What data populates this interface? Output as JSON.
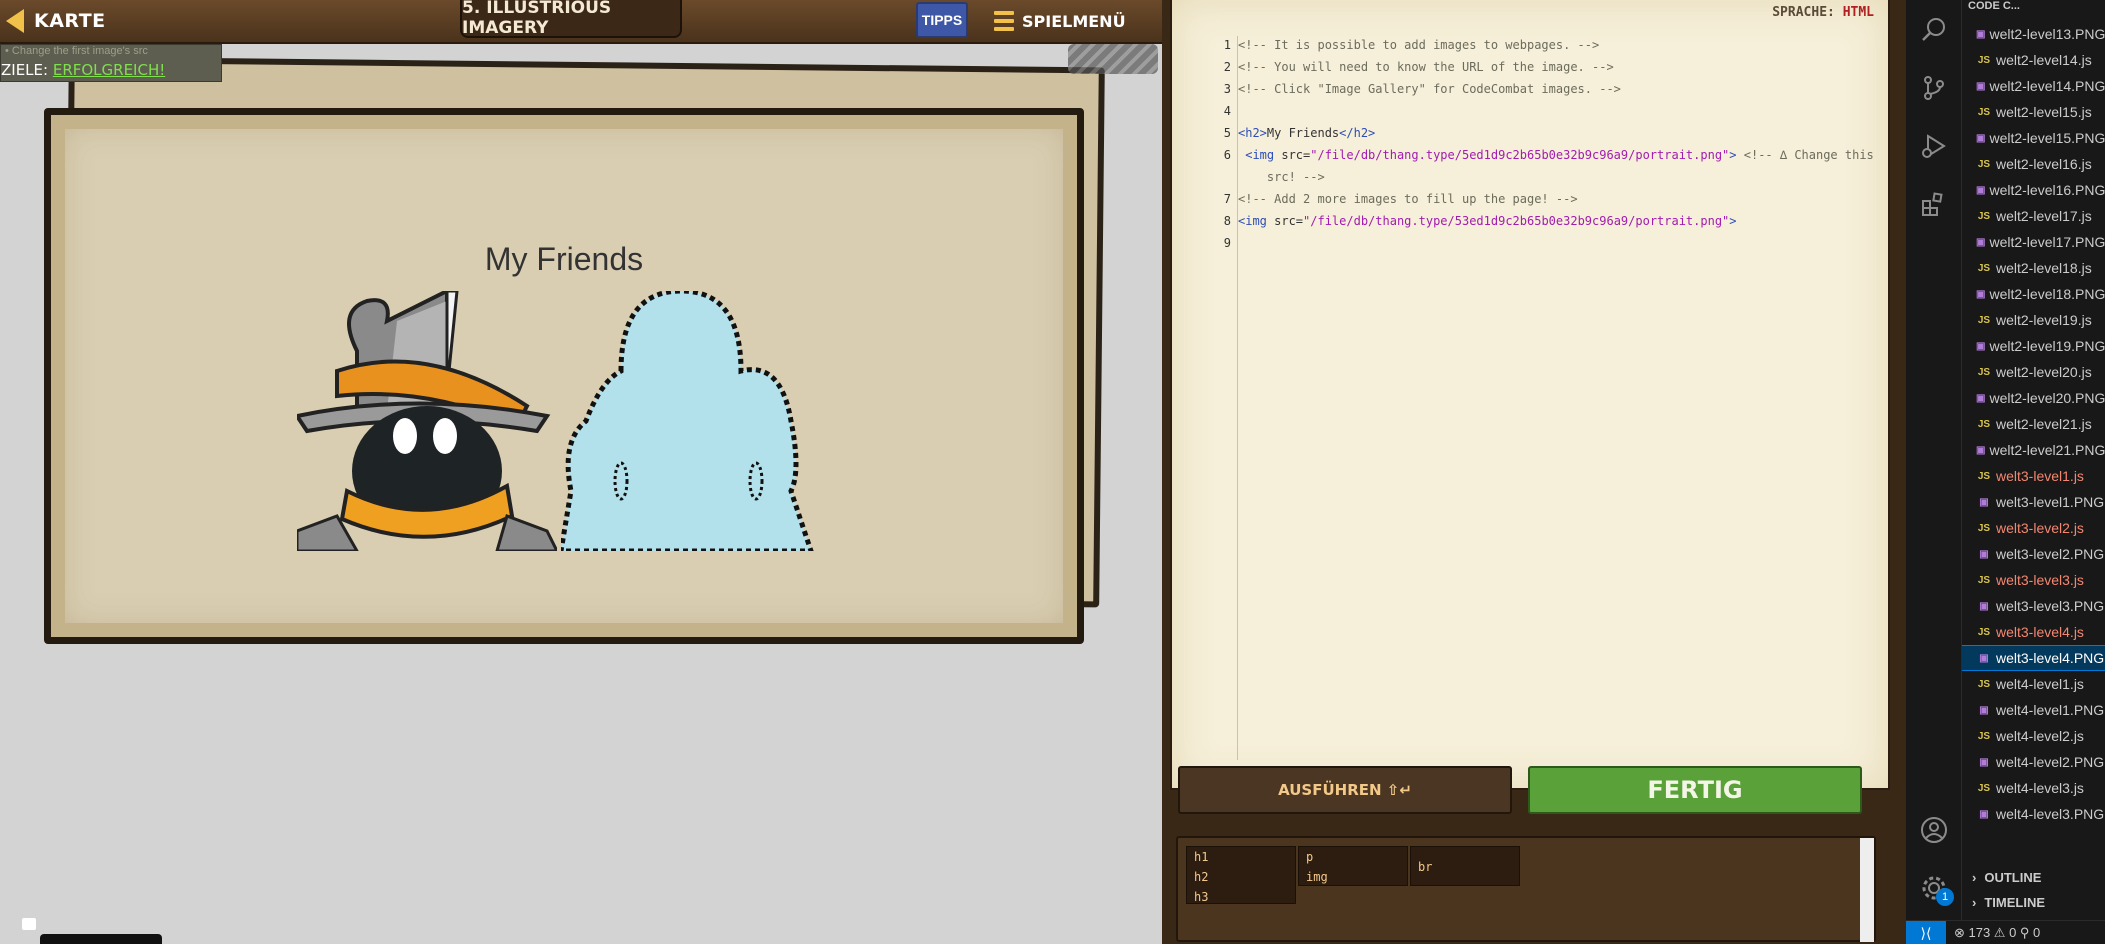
{
  "game": {
    "back_label": "KARTE",
    "level_title": "5. ILLUSTRIOUS IMAGERY",
    "hints_label": "TIPPS",
    "menu_label": "SPIELMENÜ",
    "goals_small": "• Change the first image's src",
    "goals_key": "ZIELE: ",
    "goals_status": "ERFOLGREICH!",
    "page_heading": "My Friends"
  },
  "editor": {
    "language_key": "SPRACHE: ",
    "language_value": "HTML",
    "lines": [
      {
        "n": "1",
        "parts": [
          {
            "cls": "c",
            "t": "<!-- It is possible to add images to webpages. -->"
          }
        ]
      },
      {
        "n": "2",
        "parts": [
          {
            "cls": "c",
            "t": "<!-- You will need to know the URL of the image. -->"
          }
        ]
      },
      {
        "n": "3",
        "parts": [
          {
            "cls": "c",
            "t": "<!-- Click \"Image Gallery\" for CodeCombat images. -->"
          }
        ]
      },
      {
        "n": "4",
        "parts": []
      },
      {
        "n": "5",
        "parts": [
          {
            "cls": "t",
            "t": "<h2>"
          },
          {
            "cls": "p",
            "t": "My Friends"
          },
          {
            "cls": "t",
            "t": "</h2>"
          }
        ]
      },
      {
        "n": "6",
        "parts": [
          {
            "cls": "t",
            "t": " <img"
          },
          {
            "cls": "a",
            "t": " src="
          },
          {
            "cls": "s",
            "t": "\"/file/db/thang.type/5ed1d9c2b65b0e32b9c96a9/portrait.png\""
          },
          {
            "cls": "t",
            "t": ">"
          },
          {
            "cls": "c",
            "t": " <!-- ∆ Change this"
          }
        ]
      },
      {
        "n": "",
        "parts": [
          {
            "cls": "c",
            "t": "    src! -->"
          }
        ]
      },
      {
        "n": "7",
        "parts": [
          {
            "cls": "c",
            "t": "<!-- Add 2 more images to fill up the page! -->"
          }
        ]
      },
      {
        "n": "8",
        "parts": [
          {
            "cls": "t",
            "t": "<img"
          },
          {
            "cls": "a",
            "t": " src="
          },
          {
            "cls": "s",
            "t": "\"/file/db/thang.type/53ed1d9c2b65b0e32b9c96a9/portrait.png\""
          },
          {
            "cls": "t",
            "t": ">"
          }
        ]
      },
      {
        "n": "9",
        "parts": []
      }
    ],
    "run_label": "AUSFÜHREN ⇧↵",
    "done_label": "FERTIG",
    "snippets": [
      "h1",
      "h2",
      "h3",
      "p",
      "img",
      "br"
    ]
  },
  "vscode": {
    "explorer_title": "CODE C...",
    "files": [
      {
        "name": "welt2-level13.PNG",
        "type": "img"
      },
      {
        "name": "welt2-level14.js",
        "type": "js"
      },
      {
        "name": "welt2-level14.PNG",
        "type": "img"
      },
      {
        "name": "welt2-level15.js",
        "type": "js"
      },
      {
        "name": "welt2-level15.PNG",
        "type": "img"
      },
      {
        "name": "welt2-level16.js",
        "type": "js"
      },
      {
        "name": "welt2-level16.PNG",
        "type": "img"
      },
      {
        "name": "welt2-level17.js",
        "type": "js"
      },
      {
        "name": "welt2-level17.PNG",
        "type": "img"
      },
      {
        "name": "welt2-level18.js",
        "type": "js"
      },
      {
        "name": "welt2-level18.PNG",
        "type": "img"
      },
      {
        "name": "welt2-level19.js",
        "type": "js"
      },
      {
        "name": "welt2-level19.PNG",
        "type": "img"
      },
      {
        "name": "welt2-level20.js",
        "type": "js"
      },
      {
        "name": "welt2-level20.PNG",
        "type": "img"
      },
      {
        "name": "welt2-level21.js",
        "type": "js"
      },
      {
        "name": "welt2-level21.PNG",
        "type": "img"
      },
      {
        "name": "welt3-level1.js",
        "type": "js",
        "err": true
      },
      {
        "name": "welt3-level1.PNG",
        "type": "img"
      },
      {
        "name": "welt3-level2.js",
        "type": "js",
        "err": true
      },
      {
        "name": "welt3-level2.PNG",
        "type": "img"
      },
      {
        "name": "welt3-level3.js",
        "type": "js",
        "err": true
      },
      {
        "name": "welt3-level3.PNG",
        "type": "img"
      },
      {
        "name": "welt3-level4.js",
        "type": "js",
        "err": true
      },
      {
        "name": "welt3-level4.PNG",
        "type": "img",
        "sel": true
      },
      {
        "name": "welt4-level1.js",
        "type": "js"
      },
      {
        "name": "welt4-level1.PNG",
        "type": "img"
      },
      {
        "name": "welt4-level2.js",
        "type": "js"
      },
      {
        "name": "welt4-level2.PNG",
        "type": "img"
      },
      {
        "name": "welt4-level3.js",
        "type": "js"
      },
      {
        "name": "welt4-level3.PNG",
        "type": "img"
      }
    ],
    "outline_label": "OUTLINE",
    "timeline_label": "TIMELINE",
    "settings_badge": "1",
    "status_text": "⊗ 173  ⚠ 0    ⚲ 0",
    "icons": [
      "search-icon",
      "source-control-icon",
      "run-debug-icon",
      "extensions-icon",
      "account-icon",
      "settings-icon"
    ]
  }
}
